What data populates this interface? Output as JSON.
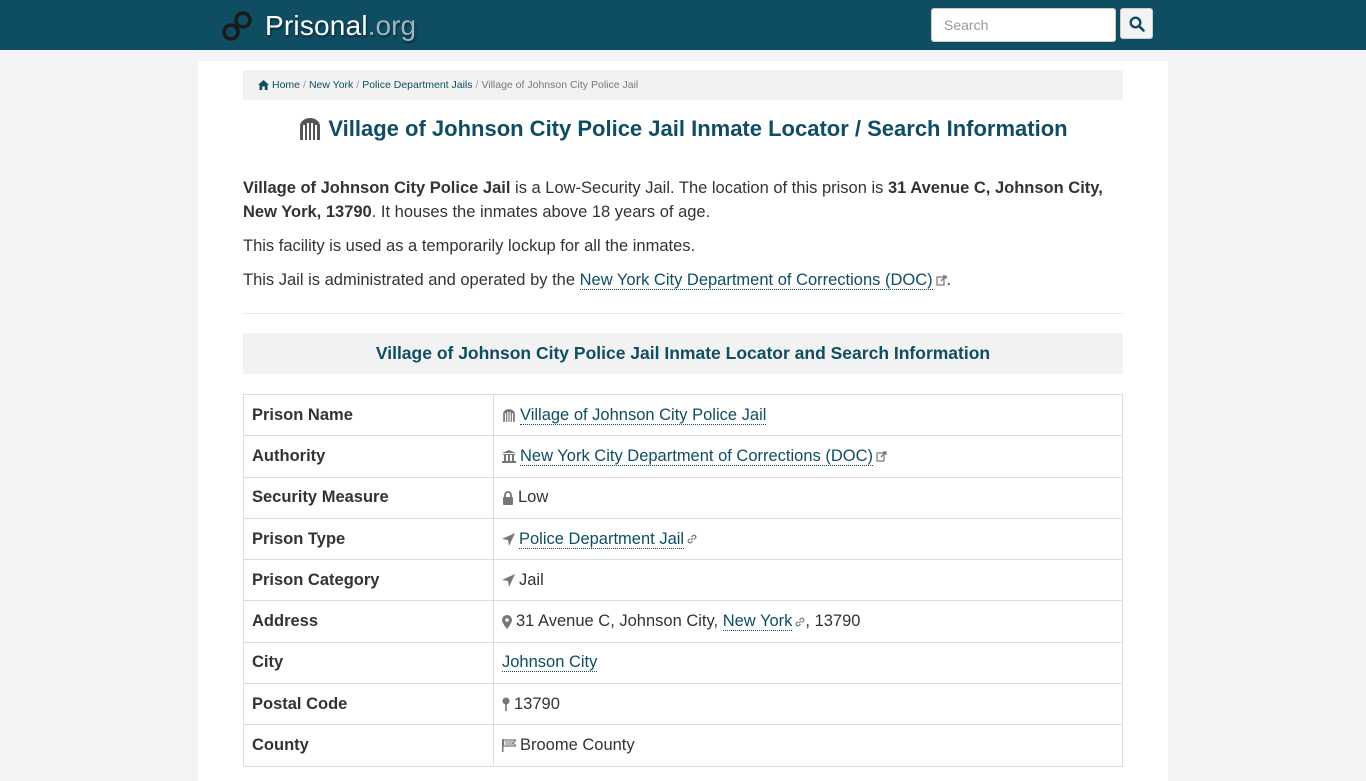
{
  "header": {
    "site_name": "Prisonal",
    "site_tld": ".org",
    "search_placeholder": "Search"
  },
  "breadcrumb": {
    "items": [
      "Home",
      "New York",
      "Police Department Jails"
    ],
    "current": "Village of Johnson City Police Jail",
    "separator": "/"
  },
  "page": {
    "title": "Village of Johnson City Police Jail Inmate Locator / Search Information"
  },
  "intro": {
    "p1_name": "Village of Johnson City Police Jail",
    "p1_text_a": " is a Low-Security Jail. The location of this prison is ",
    "p1_address": "31 Avenue C, Johnson City, New York, 13790",
    "p1_text_b": ". It houses the inmates above 18 years of age.",
    "p2": "This facility is used as a temporarily lockup for all the inmates.",
    "p3_text": "This Jail is administrated and operated by the ",
    "p3_link": "New York City Department of Corrections (DOC)",
    "p3_end": "."
  },
  "section": {
    "heading": "Village of Johnson City Police Jail Inmate Locator and Search Information"
  },
  "table": {
    "rows": [
      {
        "label": "Prison Name",
        "value": "Village of Johnson City Police Jail"
      },
      {
        "label": "Authority",
        "value": "New York City Department of Corrections (DOC)"
      },
      {
        "label": "Security Measure",
        "value": "Low"
      },
      {
        "label": "Prison Type",
        "value": "Police Department Jail"
      },
      {
        "label": "Prison Category",
        "value": "Jail"
      },
      {
        "label": "Address",
        "value_a": "31 Avenue C, Johnson City, ",
        "value_link": "New York",
        "value_b": ", 13790"
      },
      {
        "label": "City",
        "value": "Johnson City"
      },
      {
        "label": "Postal Code",
        "value": "13790"
      },
      {
        "label": "County",
        "value": "Broome County"
      }
    ]
  },
  "colors": {
    "brand": "#0f4d63",
    "background": "#f2f4f5",
    "panel": "#f2f2f2"
  },
  "icons": [
    "handcuffs-logo-icon",
    "search-icon",
    "home-icon",
    "prison-icon",
    "external-link-icon",
    "building-icon",
    "lock-icon",
    "location-arrow-icon",
    "link-icon",
    "map-marker-icon",
    "map-pin-icon",
    "flag-icon"
  ]
}
